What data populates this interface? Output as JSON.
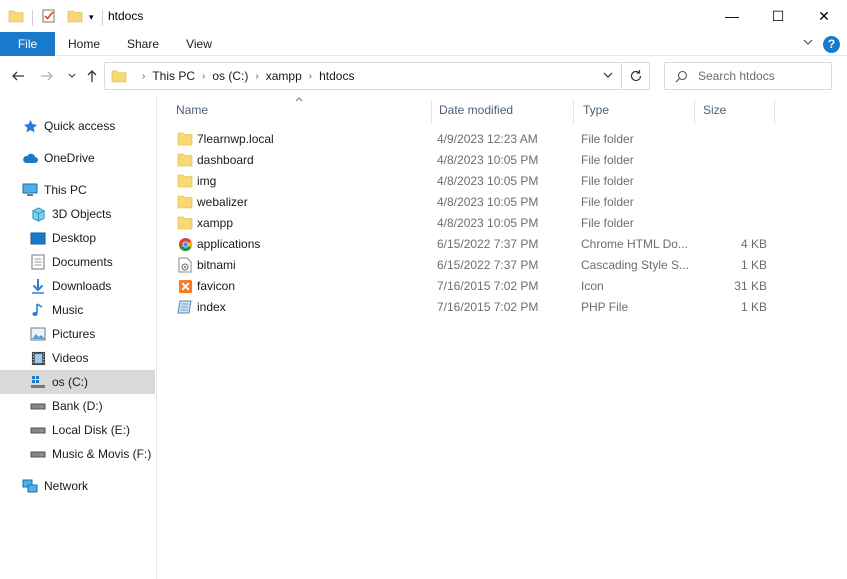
{
  "window": {
    "title": "htdocs",
    "controls": {
      "minimize": "—",
      "maximize": "☐",
      "close": "✕"
    }
  },
  "ribbon": {
    "tabs": [
      {
        "label": "File"
      },
      {
        "label": "Home"
      },
      {
        "label": "Share"
      },
      {
        "label": "View"
      }
    ],
    "help": "?"
  },
  "navigation": {
    "breadcrumb": [
      "This PC",
      "os (C:)",
      "xampp",
      "htdocs"
    ],
    "search_placeholder": "Search htdocs"
  },
  "sidebar": {
    "items": [
      {
        "label": "Quick access",
        "icon": "star-icon",
        "level": "top",
        "selected": false
      },
      {
        "label": "OneDrive",
        "icon": "cloud-icon",
        "level": "top",
        "selected": false
      },
      {
        "label": "This PC",
        "icon": "computer-icon",
        "level": "top",
        "selected": false
      },
      {
        "label": "3D Objects",
        "icon": "cube-icon",
        "level": "sub",
        "selected": false
      },
      {
        "label": "Desktop",
        "icon": "desktop-icon",
        "level": "sub",
        "selected": false
      },
      {
        "label": "Documents",
        "icon": "document-icon",
        "level": "sub",
        "selected": false
      },
      {
        "label": "Downloads",
        "icon": "download-icon",
        "level": "sub",
        "selected": false
      },
      {
        "label": "Music",
        "icon": "music-icon",
        "level": "sub",
        "selected": false
      },
      {
        "label": "Pictures",
        "icon": "picture-icon",
        "level": "sub",
        "selected": false
      },
      {
        "label": "Videos",
        "icon": "video-icon",
        "level": "sub",
        "selected": false
      },
      {
        "label": "os (C:)",
        "icon": "system-drive-icon",
        "level": "sub",
        "selected": true
      },
      {
        "label": "Bank (D:)",
        "icon": "drive-icon",
        "level": "sub",
        "selected": false
      },
      {
        "label": "Local Disk (E:)",
        "icon": "drive-icon",
        "level": "sub",
        "selected": false
      },
      {
        "label": "Music & Movis (F:)",
        "icon": "drive-icon",
        "level": "sub",
        "selected": false
      },
      {
        "label": "Network",
        "icon": "network-icon",
        "level": "top",
        "selected": false
      }
    ]
  },
  "columns": {
    "name": "Name",
    "date": "Date modified",
    "type": "Type",
    "size": "Size"
  },
  "files": [
    {
      "name": "7learnwp.local",
      "date": "4/9/2023 12:23 AM",
      "type": "File folder",
      "size": "",
      "icon": "folder-icon"
    },
    {
      "name": "dashboard",
      "date": "4/8/2023 10:05 PM",
      "type": "File folder",
      "size": "",
      "icon": "folder-icon"
    },
    {
      "name": "img",
      "date": "4/8/2023 10:05 PM",
      "type": "File folder",
      "size": "",
      "icon": "folder-icon"
    },
    {
      "name": "webalizer",
      "date": "4/8/2023 10:05 PM",
      "type": "File folder",
      "size": "",
      "icon": "folder-icon"
    },
    {
      "name": "xampp",
      "date": "4/8/2023 10:05 PM",
      "type": "File folder",
      "size": "",
      "icon": "folder-icon"
    },
    {
      "name": "applications",
      "date": "6/15/2022 7:37 PM",
      "type": "Chrome HTML Do...",
      "size": "4 KB",
      "icon": "chrome-icon"
    },
    {
      "name": "bitnami",
      "date": "6/15/2022 7:37 PM",
      "type": "Cascading Style S...",
      "size": "1 KB",
      "icon": "css-file-icon"
    },
    {
      "name": "favicon",
      "date": "7/16/2015 7:02 PM",
      "type": "Icon",
      "size": "31 KB",
      "icon": "xampp-icon"
    },
    {
      "name": "index",
      "date": "7/16/2015 7:02 PM",
      "type": "PHP File",
      "size": "1 KB",
      "icon": "php-file-icon"
    }
  ],
  "colors": {
    "accent": "#1979ca",
    "folder": "#f8d775",
    "selected": "#d9d9d9"
  }
}
